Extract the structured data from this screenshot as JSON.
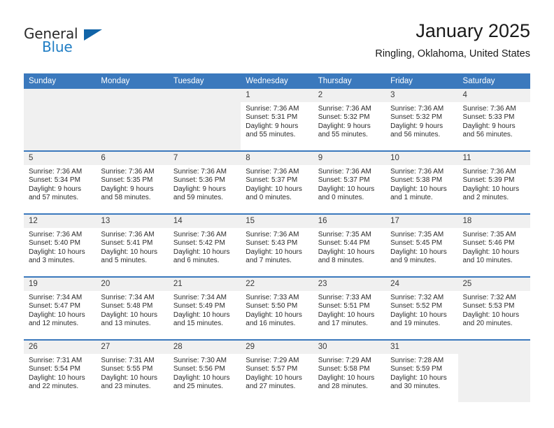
{
  "brand": {
    "line1": "General",
    "line2": "Blue",
    "accent_color": "#1164a8",
    "text_color": "#2b2b2b"
  },
  "header": {
    "title": "January 2025",
    "subtitle": "Ringling, Oklahoma, United States"
  },
  "calendar": {
    "header_bg": "#3b79bd",
    "weekdays": [
      "Sunday",
      "Monday",
      "Tuesday",
      "Wednesday",
      "Thursday",
      "Friday",
      "Saturday"
    ],
    "weeks": [
      [
        {
          "day": "",
          "empty": true
        },
        {
          "day": "",
          "empty": true
        },
        {
          "day": "",
          "empty": true
        },
        {
          "day": "1",
          "sunrise": "Sunrise: 7:36 AM",
          "sunset": "Sunset: 5:31 PM",
          "daylight1": "Daylight: 9 hours",
          "daylight2": "and 55 minutes."
        },
        {
          "day": "2",
          "sunrise": "Sunrise: 7:36 AM",
          "sunset": "Sunset: 5:32 PM",
          "daylight1": "Daylight: 9 hours",
          "daylight2": "and 55 minutes."
        },
        {
          "day": "3",
          "sunrise": "Sunrise: 7:36 AM",
          "sunset": "Sunset: 5:32 PM",
          "daylight1": "Daylight: 9 hours",
          "daylight2": "and 56 minutes."
        },
        {
          "day": "4",
          "sunrise": "Sunrise: 7:36 AM",
          "sunset": "Sunset: 5:33 PM",
          "daylight1": "Daylight: 9 hours",
          "daylight2": "and 56 minutes."
        }
      ],
      [
        {
          "day": "5",
          "sunrise": "Sunrise: 7:36 AM",
          "sunset": "Sunset: 5:34 PM",
          "daylight1": "Daylight: 9 hours",
          "daylight2": "and 57 minutes."
        },
        {
          "day": "6",
          "sunrise": "Sunrise: 7:36 AM",
          "sunset": "Sunset: 5:35 PM",
          "daylight1": "Daylight: 9 hours",
          "daylight2": "and 58 minutes."
        },
        {
          "day": "7",
          "sunrise": "Sunrise: 7:36 AM",
          "sunset": "Sunset: 5:36 PM",
          "daylight1": "Daylight: 9 hours",
          "daylight2": "and 59 minutes."
        },
        {
          "day": "8",
          "sunrise": "Sunrise: 7:36 AM",
          "sunset": "Sunset: 5:37 PM",
          "daylight1": "Daylight: 10 hours",
          "daylight2": "and 0 minutes."
        },
        {
          "day": "9",
          "sunrise": "Sunrise: 7:36 AM",
          "sunset": "Sunset: 5:37 PM",
          "daylight1": "Daylight: 10 hours",
          "daylight2": "and 0 minutes."
        },
        {
          "day": "10",
          "sunrise": "Sunrise: 7:36 AM",
          "sunset": "Sunset: 5:38 PM",
          "daylight1": "Daylight: 10 hours",
          "daylight2": "and 1 minute."
        },
        {
          "day": "11",
          "sunrise": "Sunrise: 7:36 AM",
          "sunset": "Sunset: 5:39 PM",
          "daylight1": "Daylight: 10 hours",
          "daylight2": "and 2 minutes."
        }
      ],
      [
        {
          "day": "12",
          "sunrise": "Sunrise: 7:36 AM",
          "sunset": "Sunset: 5:40 PM",
          "daylight1": "Daylight: 10 hours",
          "daylight2": "and 3 minutes."
        },
        {
          "day": "13",
          "sunrise": "Sunrise: 7:36 AM",
          "sunset": "Sunset: 5:41 PM",
          "daylight1": "Daylight: 10 hours",
          "daylight2": "and 5 minutes."
        },
        {
          "day": "14",
          "sunrise": "Sunrise: 7:36 AM",
          "sunset": "Sunset: 5:42 PM",
          "daylight1": "Daylight: 10 hours",
          "daylight2": "and 6 minutes."
        },
        {
          "day": "15",
          "sunrise": "Sunrise: 7:36 AM",
          "sunset": "Sunset: 5:43 PM",
          "daylight1": "Daylight: 10 hours",
          "daylight2": "and 7 minutes."
        },
        {
          "day": "16",
          "sunrise": "Sunrise: 7:35 AM",
          "sunset": "Sunset: 5:44 PM",
          "daylight1": "Daylight: 10 hours",
          "daylight2": "and 8 minutes."
        },
        {
          "day": "17",
          "sunrise": "Sunrise: 7:35 AM",
          "sunset": "Sunset: 5:45 PM",
          "daylight1": "Daylight: 10 hours",
          "daylight2": "and 9 minutes."
        },
        {
          "day": "18",
          "sunrise": "Sunrise: 7:35 AM",
          "sunset": "Sunset: 5:46 PM",
          "daylight1": "Daylight: 10 hours",
          "daylight2": "and 10 minutes."
        }
      ],
      [
        {
          "day": "19",
          "sunrise": "Sunrise: 7:34 AM",
          "sunset": "Sunset: 5:47 PM",
          "daylight1": "Daylight: 10 hours",
          "daylight2": "and 12 minutes."
        },
        {
          "day": "20",
          "sunrise": "Sunrise: 7:34 AM",
          "sunset": "Sunset: 5:48 PM",
          "daylight1": "Daylight: 10 hours",
          "daylight2": "and 13 minutes."
        },
        {
          "day": "21",
          "sunrise": "Sunrise: 7:34 AM",
          "sunset": "Sunset: 5:49 PM",
          "daylight1": "Daylight: 10 hours",
          "daylight2": "and 15 minutes."
        },
        {
          "day": "22",
          "sunrise": "Sunrise: 7:33 AM",
          "sunset": "Sunset: 5:50 PM",
          "daylight1": "Daylight: 10 hours",
          "daylight2": "and 16 minutes."
        },
        {
          "day": "23",
          "sunrise": "Sunrise: 7:33 AM",
          "sunset": "Sunset: 5:51 PM",
          "daylight1": "Daylight: 10 hours",
          "daylight2": "and 17 minutes."
        },
        {
          "day": "24",
          "sunrise": "Sunrise: 7:32 AM",
          "sunset": "Sunset: 5:52 PM",
          "daylight1": "Daylight: 10 hours",
          "daylight2": "and 19 minutes."
        },
        {
          "day": "25",
          "sunrise": "Sunrise: 7:32 AM",
          "sunset": "Sunset: 5:53 PM",
          "daylight1": "Daylight: 10 hours",
          "daylight2": "and 20 minutes."
        }
      ],
      [
        {
          "day": "26",
          "sunrise": "Sunrise: 7:31 AM",
          "sunset": "Sunset: 5:54 PM",
          "daylight1": "Daylight: 10 hours",
          "daylight2": "and 22 minutes."
        },
        {
          "day": "27",
          "sunrise": "Sunrise: 7:31 AM",
          "sunset": "Sunset: 5:55 PM",
          "daylight1": "Daylight: 10 hours",
          "daylight2": "and 23 minutes."
        },
        {
          "day": "28",
          "sunrise": "Sunrise: 7:30 AM",
          "sunset": "Sunset: 5:56 PM",
          "daylight1": "Daylight: 10 hours",
          "daylight2": "and 25 minutes."
        },
        {
          "day": "29",
          "sunrise": "Sunrise: 7:29 AM",
          "sunset": "Sunset: 5:57 PM",
          "daylight1": "Daylight: 10 hours",
          "daylight2": "and 27 minutes."
        },
        {
          "day": "30",
          "sunrise": "Sunrise: 7:29 AM",
          "sunset": "Sunset: 5:58 PM",
          "daylight1": "Daylight: 10 hours",
          "daylight2": "and 28 minutes."
        },
        {
          "day": "31",
          "sunrise": "Sunrise: 7:28 AM",
          "sunset": "Sunset: 5:59 PM",
          "daylight1": "Daylight: 10 hours",
          "daylight2": "and 30 minutes."
        },
        {
          "day": "",
          "empty": true
        }
      ]
    ]
  }
}
